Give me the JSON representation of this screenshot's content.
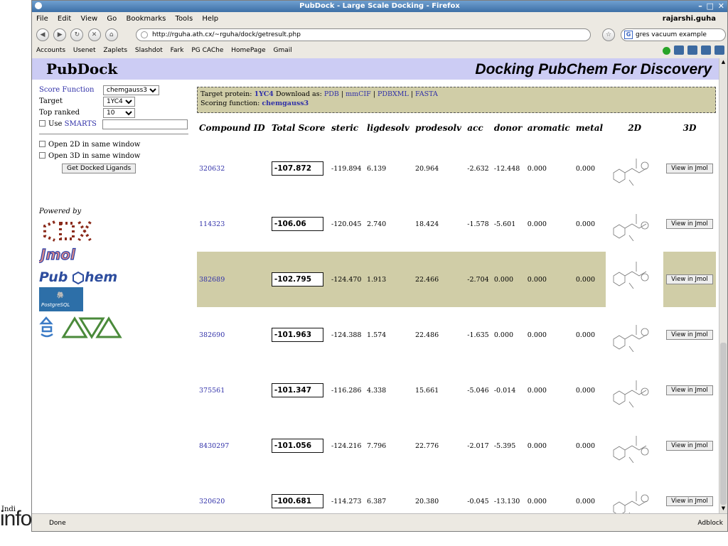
{
  "window": {
    "title": "PubDock - Large Scale Docking - Firefox"
  },
  "menu": [
    "File",
    "Edit",
    "View",
    "Go",
    "Bookmarks",
    "Tools",
    "Help"
  ],
  "user": "rajarshi.guha",
  "url": "http://rguha.ath.cx/~rguha/dock/getresult.php",
  "search_text": "gres vacuum example",
  "bookmarks": [
    "Accounts",
    "Usenet",
    "Zaplets",
    "Slashdot",
    "Fark",
    "PG CAChe",
    "HomePage",
    "Gmail"
  ],
  "header": {
    "logo": "PubDock",
    "tagline": "Docking PubChem For Discovery"
  },
  "sidebar": {
    "score_label": "Score Function",
    "score_value": "chemgauss3",
    "target_label": "Target",
    "target_value": "1YC4",
    "top_label": "Top ranked",
    "top_value": "10",
    "use_label": "Use",
    "smarts_link": "SMARTS",
    "open2d": "Open 2D in same window",
    "open3d": "Open 3D in same window",
    "get_button": "Get Docked Ligands",
    "powered_by": "Powered by"
  },
  "target_info": {
    "protein_label": "Target protein:",
    "protein": "1YC4",
    "download_label": "Download as:",
    "formats": [
      "PDB",
      "mmCIF",
      "PDBXML",
      "FASTA"
    ],
    "scoring_label": "Scoring function:",
    "scoring": "chemgauss3"
  },
  "table": {
    "headers": [
      "Compound ID",
      "Total Score",
      "steric",
      "ligdesolv",
      "prodesolv",
      "acc",
      "donor",
      "aromatic",
      "metal",
      "2D",
      "3D"
    ],
    "view_label": "View in Jmol",
    "rows": [
      {
        "id": "320632",
        "score": "-107.872",
        "steric": "-119.894",
        "ligdesolv": "6.139",
        "prodesolv": "20.964",
        "acc": "-2.632",
        "donor": "-12.448",
        "aromatic": "0.000",
        "metal": "0.000"
      },
      {
        "id": "114323",
        "score": "-106.06",
        "steric": "-120.045",
        "ligdesolv": "2.740",
        "prodesolv": "18.424",
        "acc": "-1.578",
        "donor": "-5.601",
        "aromatic": "0.000",
        "metal": "0.000"
      },
      {
        "id": "382689",
        "score": "-102.795",
        "steric": "-124.470",
        "ligdesolv": "1.913",
        "prodesolv": "22.466",
        "acc": "-2.704",
        "donor": "0.000",
        "aromatic": "0.000",
        "metal": "0.000"
      },
      {
        "id": "382690",
        "score": "-101.963",
        "steric": "-124.388",
        "ligdesolv": "1.574",
        "prodesolv": "22.486",
        "acc": "-1.635",
        "donor": "0.000",
        "aromatic": "0.000",
        "metal": "0.000"
      },
      {
        "id": "375561",
        "score": "-101.347",
        "steric": "-116.286",
        "ligdesolv": "4.338",
        "prodesolv": "15.661",
        "acc": "-5.046",
        "donor": "-0.014",
        "aromatic": "0.000",
        "metal": "0.000"
      },
      {
        "id": "8430297",
        "score": "-101.056",
        "steric": "-124.216",
        "ligdesolv": "7.796",
        "prodesolv": "22.776",
        "acc": "-2.017",
        "donor": "-5.395",
        "aromatic": "0.000",
        "metal": "0.000"
      },
      {
        "id": "320620",
        "score": "-100.681",
        "steric": "-114.273",
        "ligdesolv": "6.387",
        "prodesolv": "20.380",
        "acc": "-0.045",
        "donor": "-13.130",
        "aromatic": "0.000",
        "metal": "0.000"
      }
    ]
  },
  "status": "Done",
  "adblock": "Adblock",
  "background_text": {
    "fragment": "Indi",
    "word": "informatics"
  }
}
